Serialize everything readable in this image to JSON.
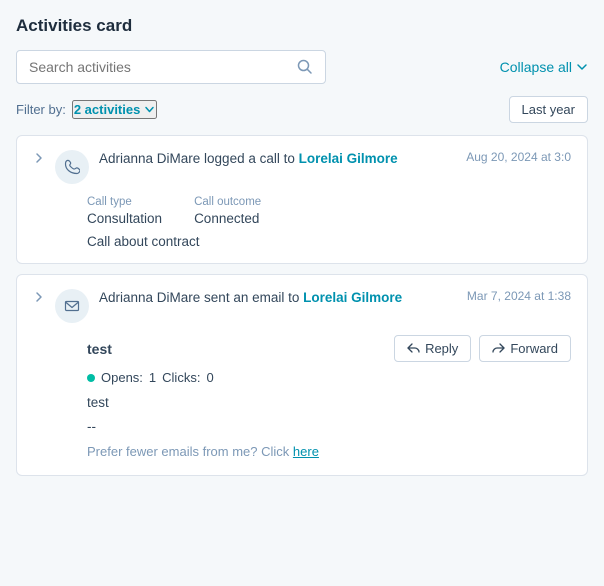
{
  "page": {
    "title": "Activities card"
  },
  "search": {
    "placeholder": "Search activities"
  },
  "toolbar": {
    "collapse_label": "Collapse all",
    "last_year_label": "Last year"
  },
  "filter": {
    "label": "Filter by:",
    "badge": "2 activities"
  },
  "activities": [
    {
      "id": "call-activity",
      "type": "call",
      "text_before": "Adrianna DiMare logged a call to",
      "linked_name": "Lorelai Gilmore",
      "timestamp": "Aug 20, 2024 at 3:0",
      "details": {
        "call_type_label": "Call type",
        "call_type_value": "Consultation",
        "call_outcome_label": "Call outcome",
        "call_outcome_value": "Connected",
        "notes": "Call about contract"
      }
    },
    {
      "id": "email-activity",
      "type": "email",
      "text_before": "Adrianna DiMare sent an email to",
      "linked_name": "Lorelai Gilmore",
      "timestamp": "Mar 7, 2024 at 1:38",
      "details": {
        "subject": "test",
        "opens_label": "Opens:",
        "opens_value": "1",
        "clicks_label": "Clicks:",
        "clicks_value": "0",
        "body_line1": "test",
        "body_line2": "--",
        "body_line3": "Prefer fewer emails from me? Click"
      },
      "actions": {
        "reply_label": "Reply",
        "forward_label": "Forward"
      }
    }
  ]
}
